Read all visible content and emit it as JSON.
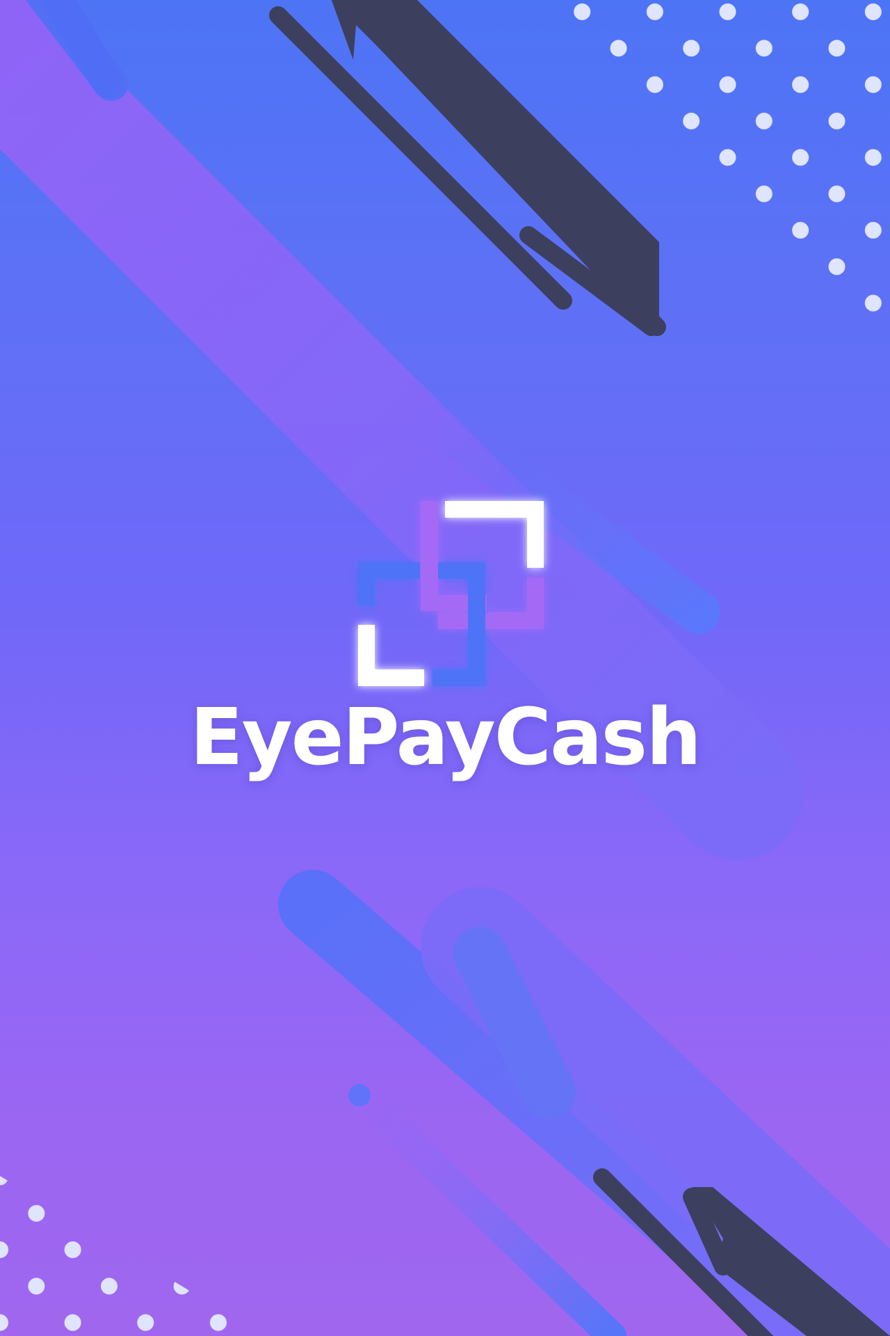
{
  "app": {
    "brand_name": "EyePayCash"
  },
  "colors": {
    "background_top": "#4d74f5",
    "background_bottom": "#a067ee",
    "accent_purple": "#a46bf5",
    "accent_blue": "#4f73f7",
    "dark_stripe": "#3c3f5e",
    "dot": "#dfe5ff",
    "logo_white": "#ffffff"
  },
  "icons": {
    "logo": "interlocking-squares-logo-icon"
  }
}
